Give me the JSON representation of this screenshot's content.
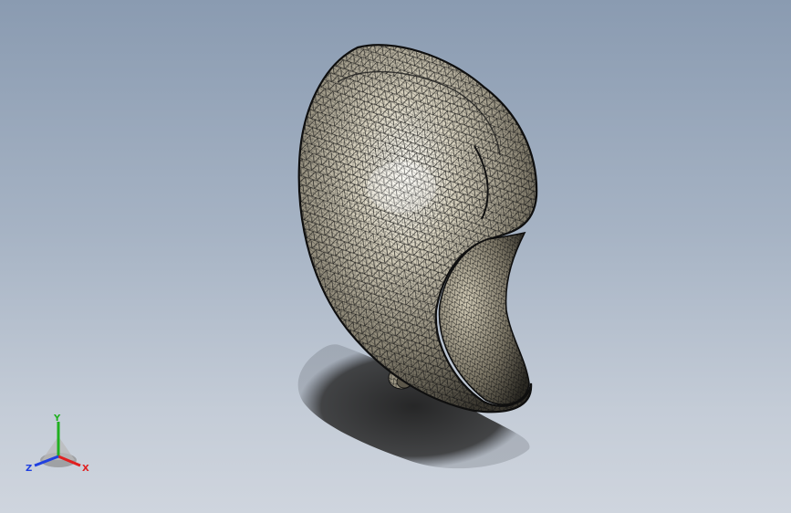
{
  "viewport": {
    "background_top": "#8a9bb1",
    "background_bottom": "#cfd5de"
  },
  "model": {
    "display_mode": "shaded-with-mesh-edges",
    "face_color": "#b8b09a",
    "edge_color": "#1a1a1a",
    "shadow": true
  },
  "triad": {
    "x_label": "X",
    "y_label": "Y",
    "z_label": "Z",
    "x_color": "#e02020",
    "y_color": "#20b020",
    "z_color": "#2040e0"
  }
}
